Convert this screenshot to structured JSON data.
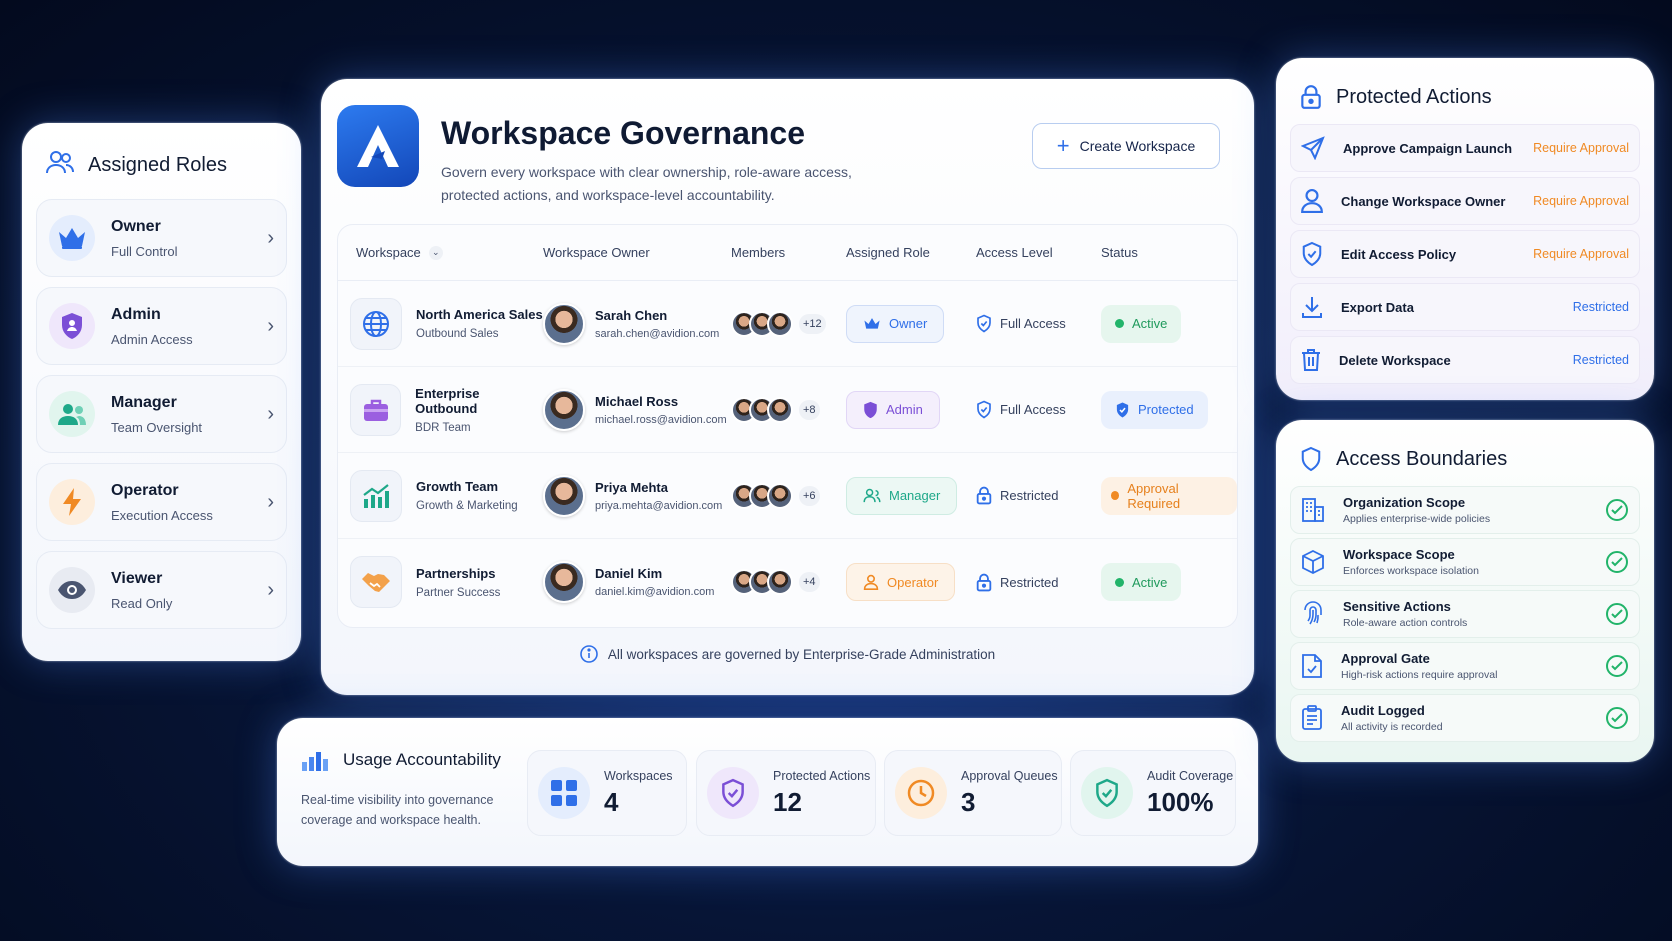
{
  "roles": {
    "title": "Assigned Roles",
    "items": [
      {
        "name": "Owner",
        "sub": "Full Control"
      },
      {
        "name": "Admin",
        "sub": "Admin Access"
      },
      {
        "name": "Manager",
        "sub": "Team Oversight"
      },
      {
        "name": "Operator",
        "sub": "Execution Access"
      },
      {
        "name": "Viewer",
        "sub": "Read Only"
      }
    ]
  },
  "governance": {
    "title": "Workspace Governance",
    "subtitle": "Govern every workspace with clear ownership, role-aware access, protected actions, and workspace-level accountability.",
    "create_label": "Create Workspace",
    "columns": [
      "Workspace",
      "Workspace Owner",
      "Members",
      "Assigned Role",
      "Access Level",
      "Status"
    ],
    "rows": [
      {
        "workspace": "North America Sales",
        "team": "Outbound Sales",
        "owner": "Sarah Chen",
        "email": "sarah.chen@avidion.com",
        "more": "+12",
        "role": "Owner",
        "access": "Full Access",
        "status": "Active"
      },
      {
        "workspace": "Enterprise Outbound",
        "team": "BDR Team",
        "owner": "Michael Ross",
        "email": "michael.ross@avidion.com",
        "more": "+8",
        "role": "Admin",
        "access": "Full Access",
        "status": "Protected"
      },
      {
        "workspace": "Growth Team",
        "team": "Growth & Marketing",
        "owner": "Priya Mehta",
        "email": "priya.mehta@avidion.com",
        "more": "+6",
        "role": "Manager",
        "access": "Restricted",
        "status": "Approval Required"
      },
      {
        "workspace": "Partnerships",
        "team": "Partner Success",
        "owner": "Daniel Kim",
        "email": "daniel.kim@avidion.com",
        "more": "+4",
        "role": "Operator",
        "access": "Restricted",
        "status": "Active"
      }
    ],
    "footnote": "All workspaces are governed by Enterprise-Grade Administration"
  },
  "usage": {
    "title": "Usage Accountability",
    "subtitle": "Real-time visibility into governance coverage and workspace health.",
    "stats": [
      {
        "label": "Workspaces",
        "value": "4"
      },
      {
        "label": "Protected Actions",
        "value": "12"
      },
      {
        "label": "Approval Queues",
        "value": "3"
      },
      {
        "label": "Audit Coverage",
        "value": "100%"
      }
    ]
  },
  "protected": {
    "title": "Protected Actions",
    "items": [
      {
        "label": "Approve Campaign Launch",
        "req": "Require Approval"
      },
      {
        "label": "Change Workspace Owner",
        "req": "Require Approval"
      },
      {
        "label": "Edit Access Policy",
        "req": "Require Approval"
      },
      {
        "label": "Export Data",
        "req": "Restricted"
      },
      {
        "label": "Delete Workspace",
        "req": "Restricted"
      }
    ]
  },
  "boundaries": {
    "title": "Access Boundaries",
    "items": [
      {
        "name": "Organization Scope",
        "sub": "Applies enterprise-wide policies"
      },
      {
        "name": "Workspace Scope",
        "sub": "Enforces workspace isolation"
      },
      {
        "name": "Sensitive Actions",
        "sub": "Role-aware action controls"
      },
      {
        "name": "Approval Gate",
        "sub": "High-risk actions require approval"
      },
      {
        "name": "Audit Logged",
        "sub": "All activity is recorded"
      }
    ]
  },
  "colors": {
    "blue": "#2f6fe8",
    "purple": "#7b4fd6",
    "teal": "#1ea889",
    "orange": "#f08a24",
    "green": "#22b46a"
  }
}
